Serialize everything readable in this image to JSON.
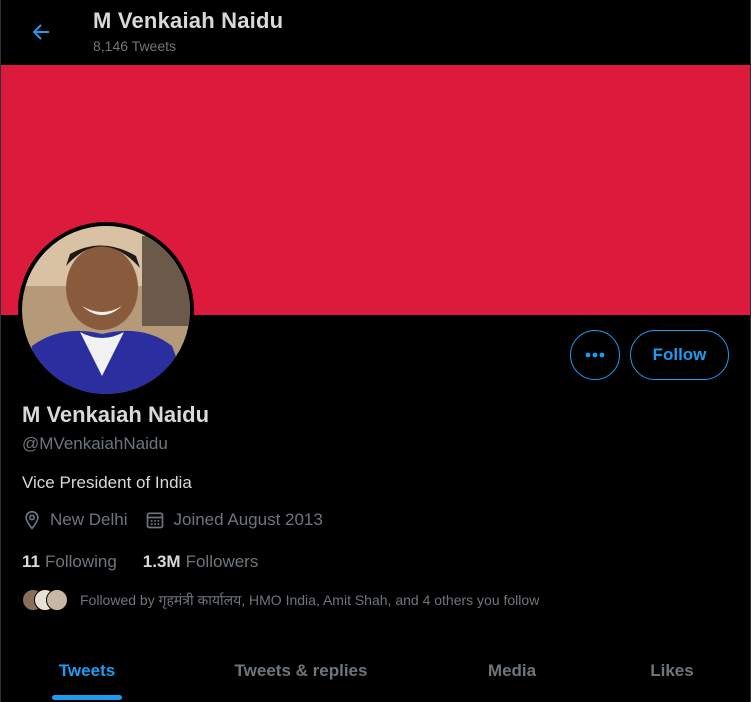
{
  "header": {
    "title": "M Venkaiah Naidu",
    "tweet_count": "8,146 Tweets"
  },
  "colors": {
    "banner": "#dc1a3c",
    "accent": "#1d9bf0",
    "background": "#000000"
  },
  "actions": {
    "more_icon": "more-horizontal-icon",
    "follow_label": "Follow"
  },
  "profile": {
    "name": "M Venkaiah Naidu",
    "handle": "@MVenkaiahNaidu",
    "bio": "Vice President of India",
    "location": "New Delhi",
    "joined": "Joined August 2013"
  },
  "counts": {
    "following_value": "11",
    "following_label": "Following",
    "followers_value": "1.3M",
    "followers_label": "Followers"
  },
  "followed_by": "Followed by गृहमंत्री कार्यालय, HMO India, Amit Shah, and 4 others you follow",
  "tabs": [
    {
      "label": "Tweets",
      "active": true
    },
    {
      "label": "Tweets & replies",
      "active": false
    },
    {
      "label": "Media",
      "active": false
    },
    {
      "label": "Likes",
      "active": false
    }
  ]
}
